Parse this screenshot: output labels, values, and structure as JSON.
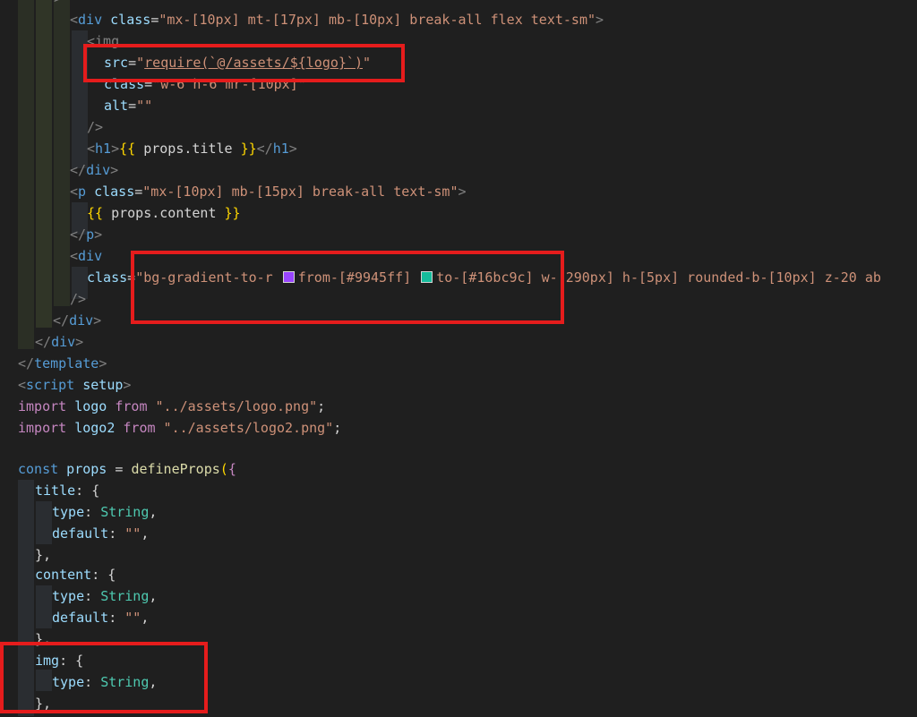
{
  "code": {
    "l1_open": "<",
    "l1_tag": "div",
    "l1_attr": " class",
    "l1_eq": "=",
    "l1_str": "\"mx-[10px] mt-[17px] mb-[10px] break-all flex text-sm\"",
    "l1_close": ">",
    "l2_text": "<img",
    "l3_attr": "src",
    "l3_eq": "=",
    "l3_q1": "\"",
    "l3_val": "require(`@/assets/${logo}`)",
    "l3_q2": "\"",
    "l4_attr": "class",
    "l4_eq": "=",
    "l4_str": "\"w-6 h-6 mr-[10px]\"",
    "l5_attr": "alt",
    "l5_eq": "=",
    "l5_str": "\"\"",
    "l6_text": "/>",
    "l7_o": "<",
    "l7_tag": "h1",
    "l7_c": ">",
    "l7_b1": "{{",
    "l7_expr": " props.title ",
    "l7_b2": "}}",
    "l7_end": "</",
    "l7_tag2": "h1",
    "l7_end2": ">",
    "l8_o": "</",
    "l8_tag": "div",
    "l8_c": ">",
    "l9_o": "<",
    "l9_tag": "p",
    "l9_attr": " class",
    "l9_eq": "=",
    "l9_str": "\"mx-[10px] mb-[15px] break-all text-sm\"",
    "l9_c": ">",
    "l10_b1": "{{",
    "l10_expr": " props.content ",
    "l10_b2": "}}",
    "l11_o": "</",
    "l11_tag": "p",
    "l11_c": ">",
    "l12_o": "<",
    "l12_tag": "div",
    "l13_attr": "class",
    "l13_eq": "=",
    "l13_s1": "\"bg-gradient-to-r ",
    "l13_s2": "from-[#9945ff] ",
    "l13_s3": "to-[#16bc9c]",
    "l13_s4": " w-[290px] h-[5px] rounded-b-[10px] z-20 ab",
    "l14_text": "/>",
    "l15_o": "</",
    "l15_tag": "div",
    "l15_c": ">",
    "l16_o": "</",
    "l16_tag": "div",
    "l16_c": ">",
    "l17_o": "</",
    "l17_tag": "template",
    "l17_c": ">",
    "l18_o": "<",
    "l18_tag": "script",
    "l18_attr": " setup",
    "l18_c": ">",
    "l19_kw": "import",
    "l19_id": " logo ",
    "l19_from": "from",
    "l19_str": " \"../assets/logo.png\"",
    "l19_semi": ";",
    "l20_kw": "import",
    "l20_id": " logo2 ",
    "l20_from": "from",
    "l20_str": " \"../assets/logo2.png\"",
    "l20_semi": ";",
    "l22_const": "const",
    "l22_id": " props ",
    "l22_eq": "= ",
    "l22_fn": "defineProps",
    "l22_paren": "(",
    "l22_brace": "{",
    "l23_key": "title",
    "l23_rest": ": ",
    "l23_brace": "{",
    "l24_key": "type",
    "l24_colon": ": ",
    "l24_type": "String",
    "l24_comma": ",",
    "l25_key": "default",
    "l25_colon": ": ",
    "l25_str": "\"\"",
    "l25_comma": ",",
    "l26_brace": "}",
    "l26_comma": ",",
    "l27_key": "content",
    "l27_rest": ": ",
    "l27_brace": "{",
    "l28_key": "type",
    "l28_colon": ": ",
    "l28_type": "String",
    "l28_comma": ",",
    "l29_key": "default",
    "l29_colon": ": ",
    "l29_str": "\"\"",
    "l29_comma": ",",
    "l30_brace": "}",
    "l30_comma": ",",
    "l31_key": "img",
    "l31_rest": ": ",
    "l31_brace": "{",
    "l32_key": "type",
    "l32_colon": ": ",
    "l32_type": "String",
    "l32_comma": ",",
    "l33_brace": "}",
    "l33_comma": ","
  },
  "colors": {
    "background": "#1f1f1f",
    "highlight_box": "#e51c1c",
    "swatch_from": "#9945ff",
    "swatch_to": "#16bc9c"
  }
}
